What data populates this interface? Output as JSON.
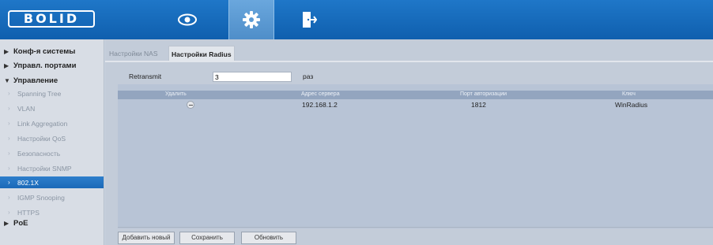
{
  "header": {
    "logo": "BOLID",
    "nav": [
      {
        "icon": "eye-icon",
        "active": false
      },
      {
        "icon": "gear-icon",
        "active": true
      },
      {
        "icon": "exit-icon",
        "active": false
      }
    ],
    "colors": {
      "header_bg": "#1a6dbf",
      "active_tab": "#5b9ad3"
    }
  },
  "sidebar": {
    "groups": [
      {
        "label": "Конф-я системы",
        "expanded": false
      },
      {
        "label": "Управл. портами",
        "expanded": false
      },
      {
        "label": "Управление",
        "expanded": true
      },
      {
        "label": "PoE",
        "expanded": false
      }
    ],
    "items": [
      {
        "label": "Spanning Tree",
        "active": false
      },
      {
        "label": "VLAN",
        "active": false
      },
      {
        "label": "Link Aggregation",
        "active": false
      },
      {
        "label": "Настройки QoS",
        "active": false
      },
      {
        "label": "Безопасность",
        "active": false
      },
      {
        "label": "Настройки SNMP",
        "active": false
      },
      {
        "label": "802.1X",
        "active": true
      },
      {
        "label": "IGMP Snooping",
        "active": false
      },
      {
        "label": "HTTPS",
        "active": false
      }
    ]
  },
  "tabs": [
    {
      "label": "Настройки NAS",
      "active": false
    },
    {
      "label": "Настройки Radius",
      "active": true
    }
  ],
  "form": {
    "retransmit_label": "Retransmit",
    "retransmit_value": "3",
    "retransmit_unit": "раз"
  },
  "table": {
    "headers": [
      "Удалить",
      "Адрес сервера",
      "Порт авторизации",
      "Ключ"
    ],
    "rows": [
      {
        "server": "192.168.1.2",
        "port": "1812",
        "key": "WinRadius"
      }
    ]
  },
  "buttons": {
    "add": "Добавить новый",
    "save": "Сохранить",
    "refresh": "Обновить"
  }
}
